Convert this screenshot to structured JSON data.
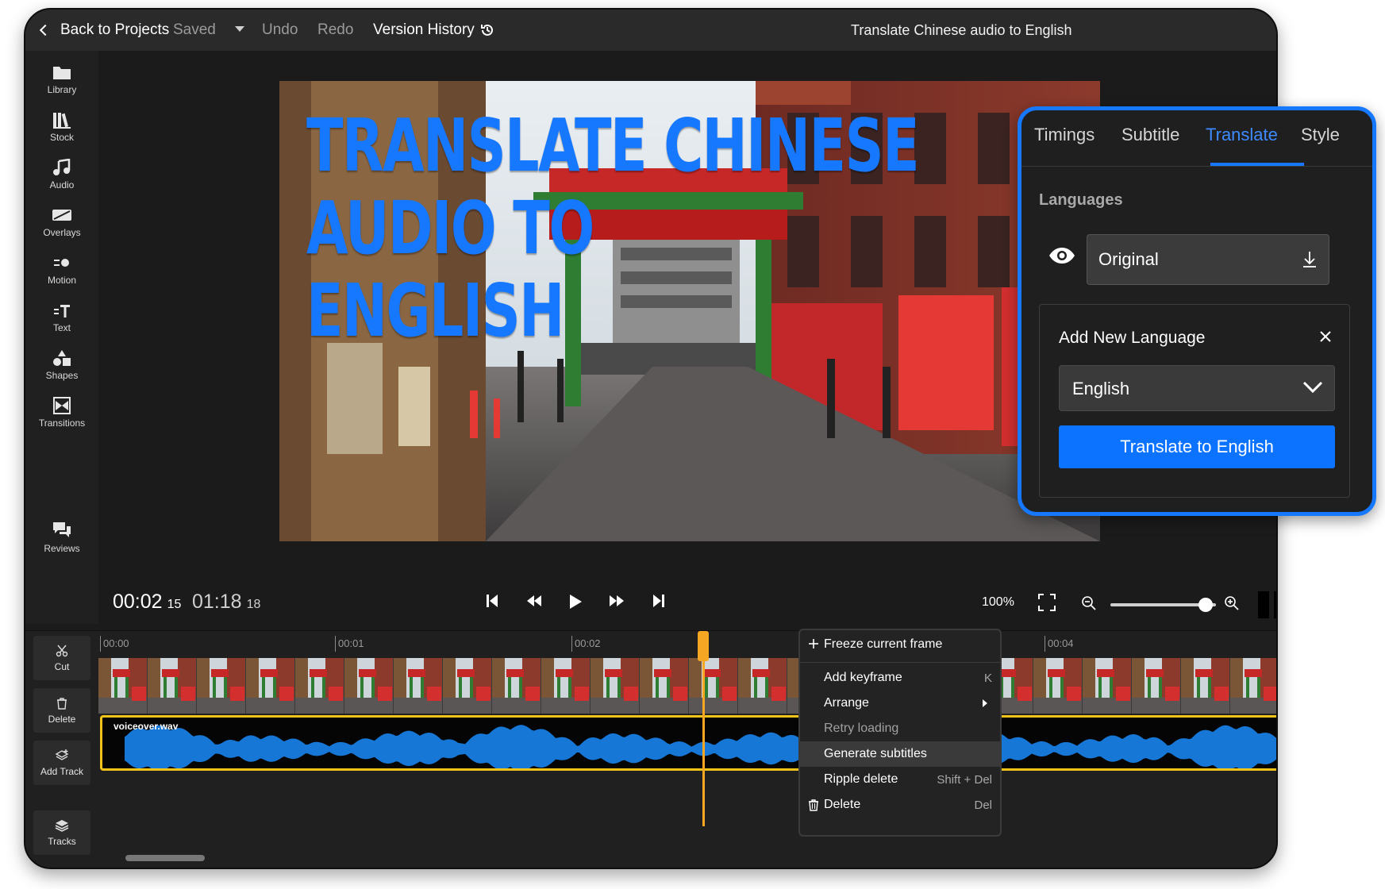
{
  "topbar": {
    "back_label": "Back to Projects",
    "saved_label": "Saved",
    "undo_label": "Undo",
    "redo_label": "Redo",
    "version_history_label": "Version History",
    "project_title": "Translate Chinese audio to English"
  },
  "sidebar": {
    "items": [
      {
        "label": "Library",
        "icon": "folder-icon"
      },
      {
        "label": "Stock",
        "icon": "stock-icon"
      },
      {
        "label": "Audio",
        "icon": "music-note-icon"
      },
      {
        "label": "Overlays",
        "icon": "overlays-icon"
      },
      {
        "label": "Motion",
        "icon": "motion-icon"
      },
      {
        "label": "Text",
        "icon": "text-icon"
      },
      {
        "label": "Shapes",
        "icon": "shapes-icon"
      },
      {
        "label": "Transitions",
        "icon": "transitions-icon"
      }
    ],
    "reviews_label": "Reviews"
  },
  "preview": {
    "headline_lines": [
      "TRANSLATE CHINESE",
      "AUDIO TO",
      "ENGLISH"
    ],
    "headline_color": "#1677ff"
  },
  "controls": {
    "current_time": "00:02",
    "current_frame": "15",
    "total_time": "01:18",
    "total_frame": "18",
    "zoom_percent": "100%",
    "zoom_level": 0.9
  },
  "timeline": {
    "tools": [
      {
        "label": "Cut",
        "icon": "scissors-icon"
      },
      {
        "label": "Delete",
        "icon": "trash-icon"
      },
      {
        "label": "Add Track",
        "icon": "add-track-icon"
      },
      {
        "label": "Tracks",
        "icon": "layers-icon"
      }
    ],
    "ruler_ticks": [
      "00:00",
      "00:01",
      "00:02",
      "00:04"
    ],
    "audio_clip_name": "voiceover.wav"
  },
  "context_menu": {
    "items": [
      {
        "label": "Freeze current frame",
        "shortcut": ""
      },
      {
        "label": "Add keyframe",
        "shortcut": "K"
      },
      {
        "label": "Arrange",
        "shortcut": ""
      },
      {
        "label": "Retry loading",
        "shortcut": ""
      },
      {
        "label": "Generate subtitles",
        "shortcut": ""
      },
      {
        "label": "Ripple delete",
        "shortcut": "Shift + Del"
      },
      {
        "label": "Delete",
        "shortcut": "Del"
      }
    ]
  },
  "panel": {
    "tabs": [
      "Timings",
      "Subtitle",
      "Translate",
      "Style"
    ],
    "active_tab": "Translate",
    "languages_label": "Languages",
    "original_label": "Original",
    "add_new_language_label": "Add New Language",
    "selected_language": "English",
    "translate_button_label": "Translate to English",
    "accent_color": "#1677ff"
  }
}
